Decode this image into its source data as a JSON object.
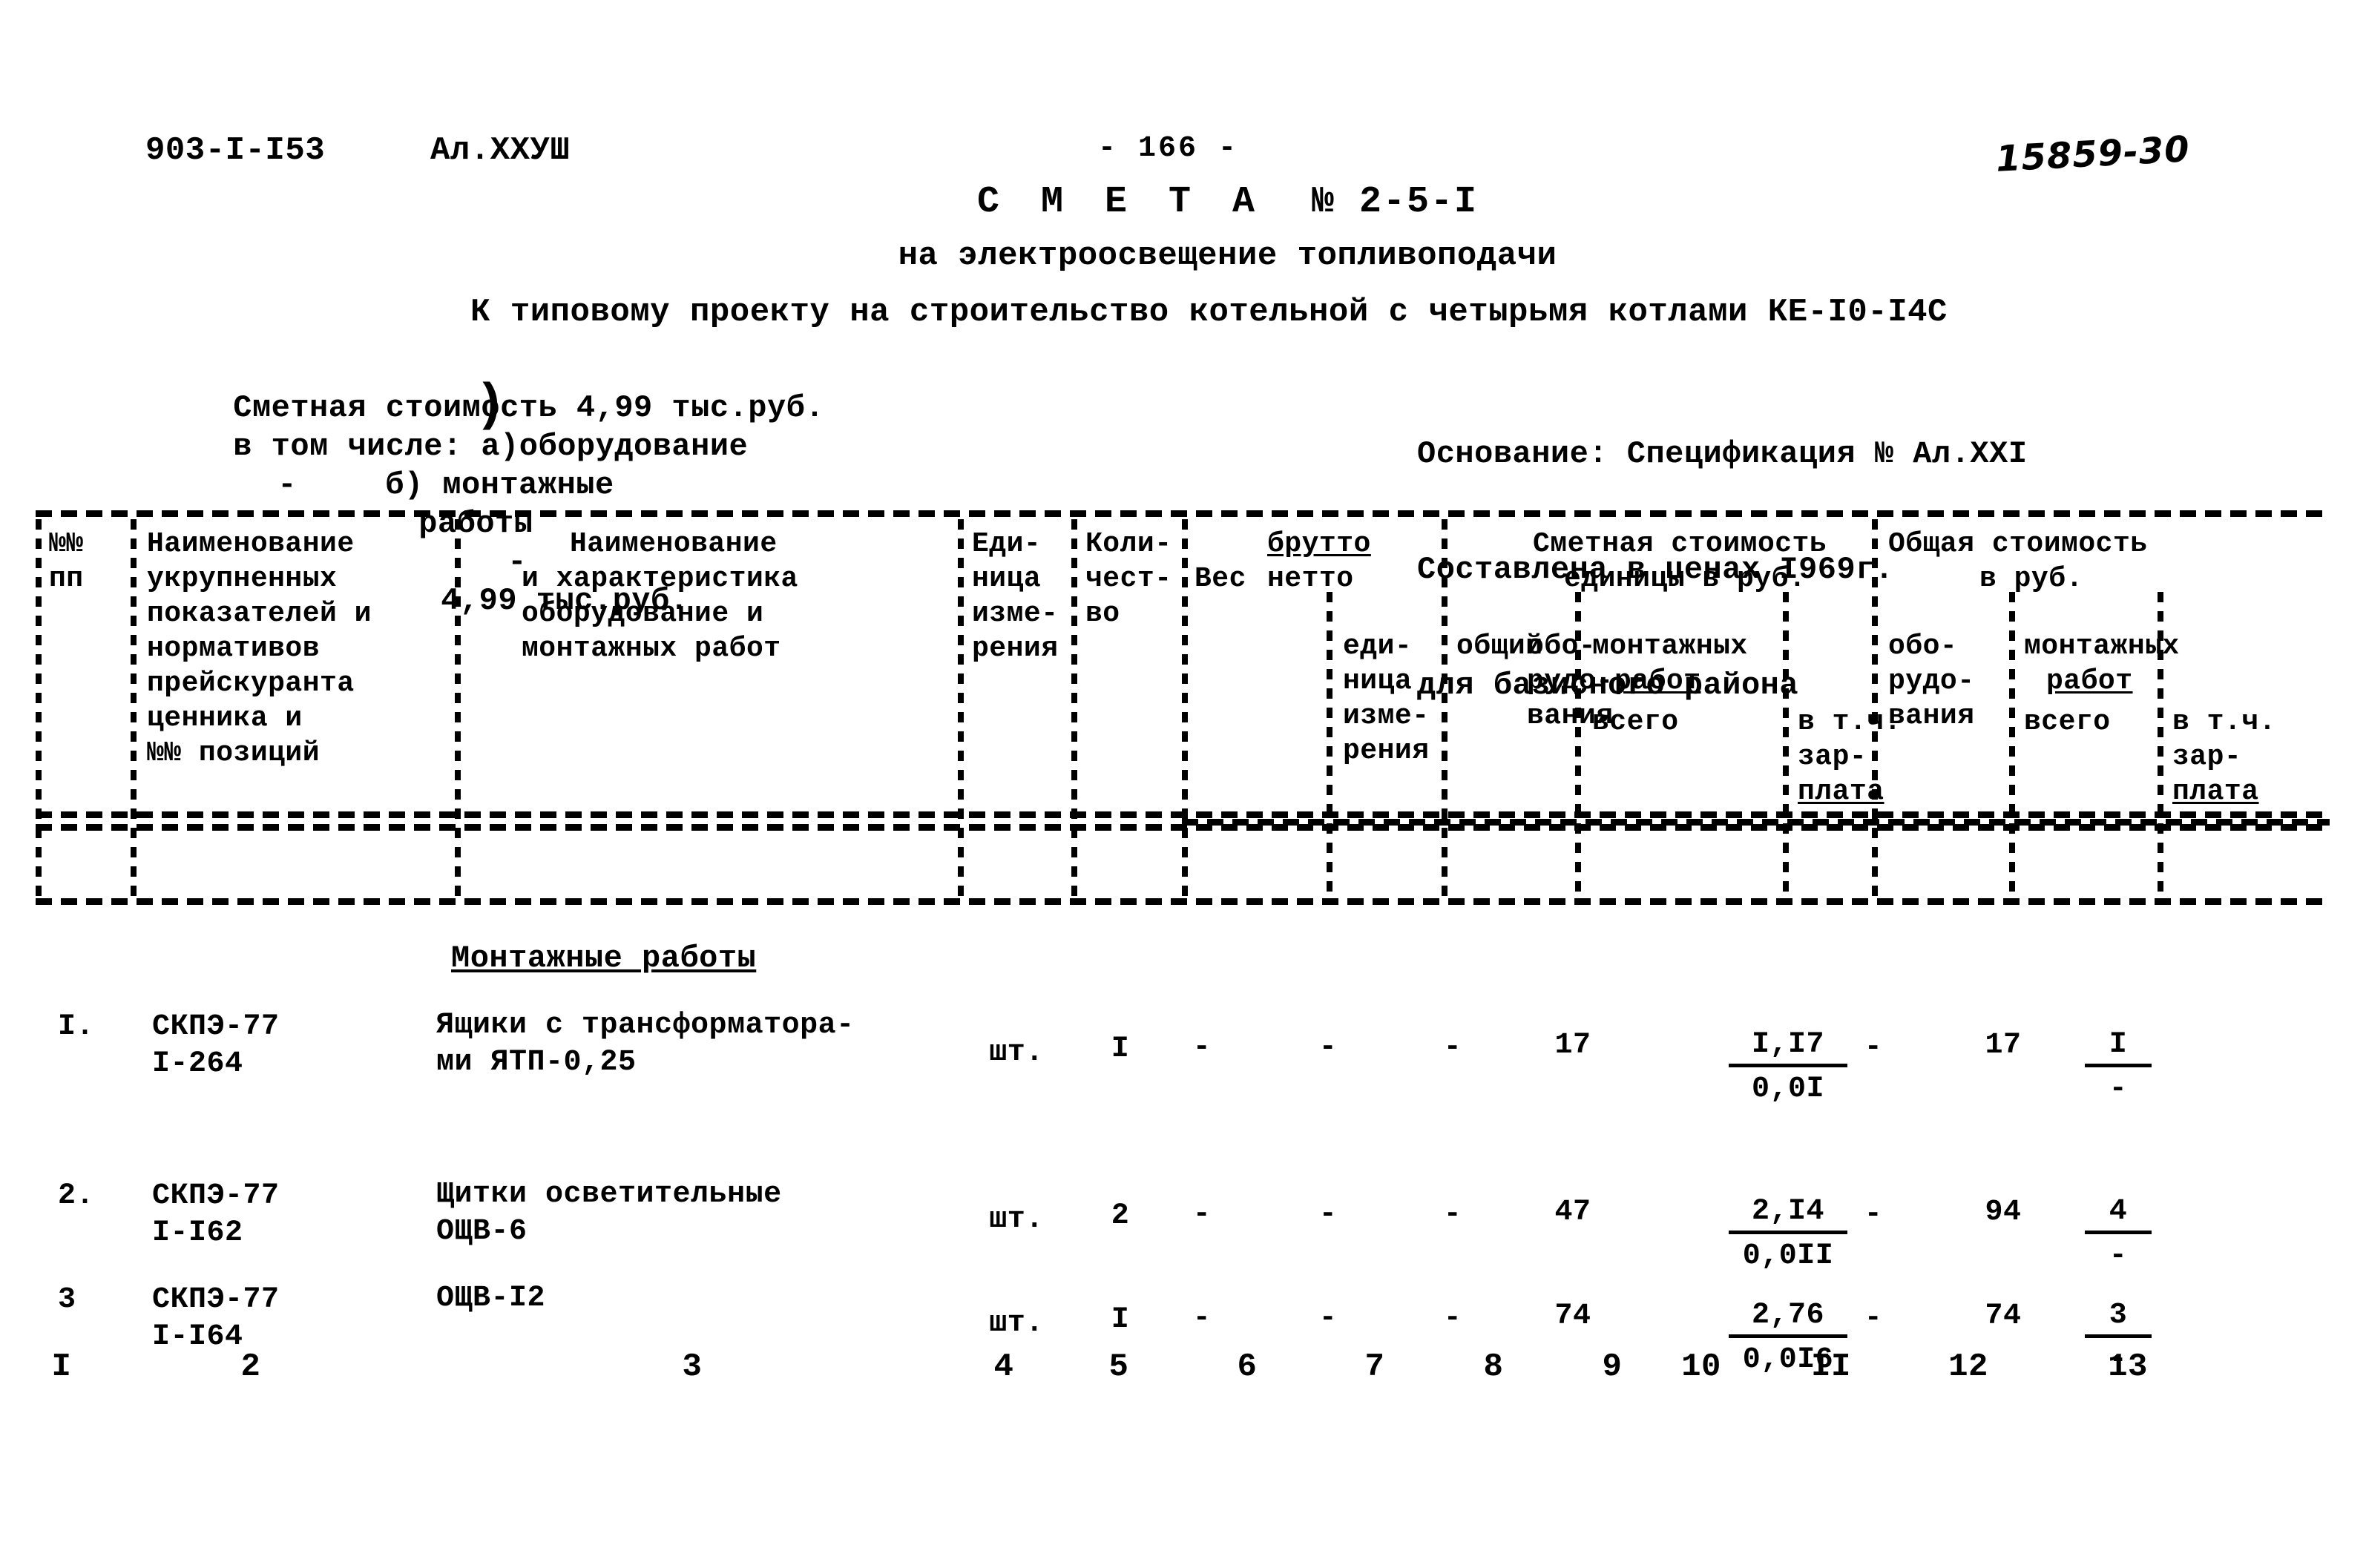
{
  "header": {
    "doc_code": "903-I-I53",
    "album_code": "Ал.XXУШ",
    "page_number": "- 166 -",
    "archive_stamp": "15859-30",
    "title_word": "С М Е Т А",
    "title_number": "№ 2-5-I",
    "subtitle": "на электроосвещение топливоподачи",
    "project_line": "К типовому проекту на строительство котельной с четырьмя котлами КЕ-I0-I4С"
  },
  "cost_summary": {
    "line1": "Сметная стоимость 4,99 тыс.руб.",
    "line2_label": "в том числе: а)оборудование",
    "line2_dash": "-",
    "line3_label": "б) монтажные",
    "line4_label": "работы",
    "line4_dash": "-",
    "line4_value": "4,99 тыс.руб."
  },
  "basis": {
    "line1": "Основание: Спецификация № Ал.XXI",
    "line2": "Составлена в ценах I969г.",
    "line3": "для базисного района"
  },
  "table": {
    "headers": {
      "c1_l1": "№№",
      "c1_l2": "пп",
      "c2_l1": "Наименование",
      "c2_l2": "укрупненных",
      "c2_l3": "показателей и",
      "c2_l4": "нормативов",
      "c2_l5": "прейскуранта",
      "c2_l6": "ценника и",
      "c2_l7": "№№ позиций",
      "c3_l1": "Наименование",
      "c3_l2": "и характеристика",
      "c3_l3": "оборудование и",
      "c3_l4": "монтажных работ",
      "c4_l1": "Еди-",
      "c4_l2": "ница",
      "c4_l3": "изме-",
      "c4_l4": "рения",
      "c5_l1": "Коли-",
      "c5_l2": "чест-",
      "c5_l3": "во",
      "weight_prefix": "Вес",
      "weight_top": "брутто",
      "weight_bottom": "нетто",
      "c6_l1": "еди-",
      "c6_l2": "ница",
      "c6_l3": "изме-",
      "c6_l4": "рения",
      "c7_l1": "общий",
      "unit_cost_l1": "Сметная стоимость",
      "unit_cost_l2": "единицы в руб.",
      "c8_l1": "обо-",
      "c8_l2": "рудо-",
      "c8_l3": "вания",
      "c9_10_l1": "монтажных",
      "c9_10_l2": "работ",
      "c9_l3": "всего",
      "c10_l3": "в т.ч.",
      "c10_l4": "зар-",
      "c10_l5": "плата",
      "total_cost_l1": "Общая стоимость",
      "total_cost_l2": "в руб.",
      "c11_l1": "обо-",
      "c11_l2": "рудо-",
      "c11_l3": "вания",
      "c12_13_l1": "монтажных",
      "c12_13_l2": "работ",
      "c12_l3": "всего",
      "c13_l3": "в т.ч.",
      "c13_l4": "зар-",
      "c13_l5": "плата"
    },
    "column_numbers": [
      "I",
      "2",
      "3",
      "4",
      "5",
      "6",
      "7",
      "8",
      "9",
      "10",
      "II",
      "12",
      "13"
    ],
    "section_label": "Монтажные работы",
    "rows": [
      {
        "no": "I.",
        "code_l1": "СКПЭ-77",
        "code_l2": "I-264",
        "name_l1": "Ящики с трансформатора-",
        "name_l2": "ми ЯТП-0,25",
        "unit": "шт.",
        "qty": "I",
        "weight_unit": "-",
        "weight_total": "-",
        "c8": "-",
        "c9": "17",
        "c10_top": "I,I7",
        "c10_bot": "0,0I",
        "c11": "-",
        "c12": "17",
        "c13_top": "I",
        "c13_bot": "-"
      },
      {
        "no": "2.",
        "code_l1": "СКПЭ-77",
        "code_l2": "I-I62",
        "name_l1": "Щитки осветительные",
        "name_l2": "ОЩВ-6",
        "unit": "шт.",
        "qty": "2",
        "weight_unit": "-",
        "weight_total": "-",
        "c8": "-",
        "c9": "47",
        "c10_top": "2,I4",
        "c10_bot": "0,0II",
        "c11": "-",
        "c12": "94",
        "c13_top": "4",
        "c13_bot": "-"
      },
      {
        "no": "3",
        "code_l1": "СКПЭ-77",
        "code_l2": "I-I64",
        "name_l1": "ОЩВ-I2",
        "name_l2": "",
        "unit": "шт.",
        "qty": "I",
        "weight_unit": "-",
        "weight_total": "-",
        "c8": "-",
        "c9": "74",
        "c10_top": "2,76",
        "c10_bot": "0,0I6",
        "c11": "-",
        "c12": "74",
        "c13_top": "3",
        "c13_bot": "-"
      }
    ]
  }
}
